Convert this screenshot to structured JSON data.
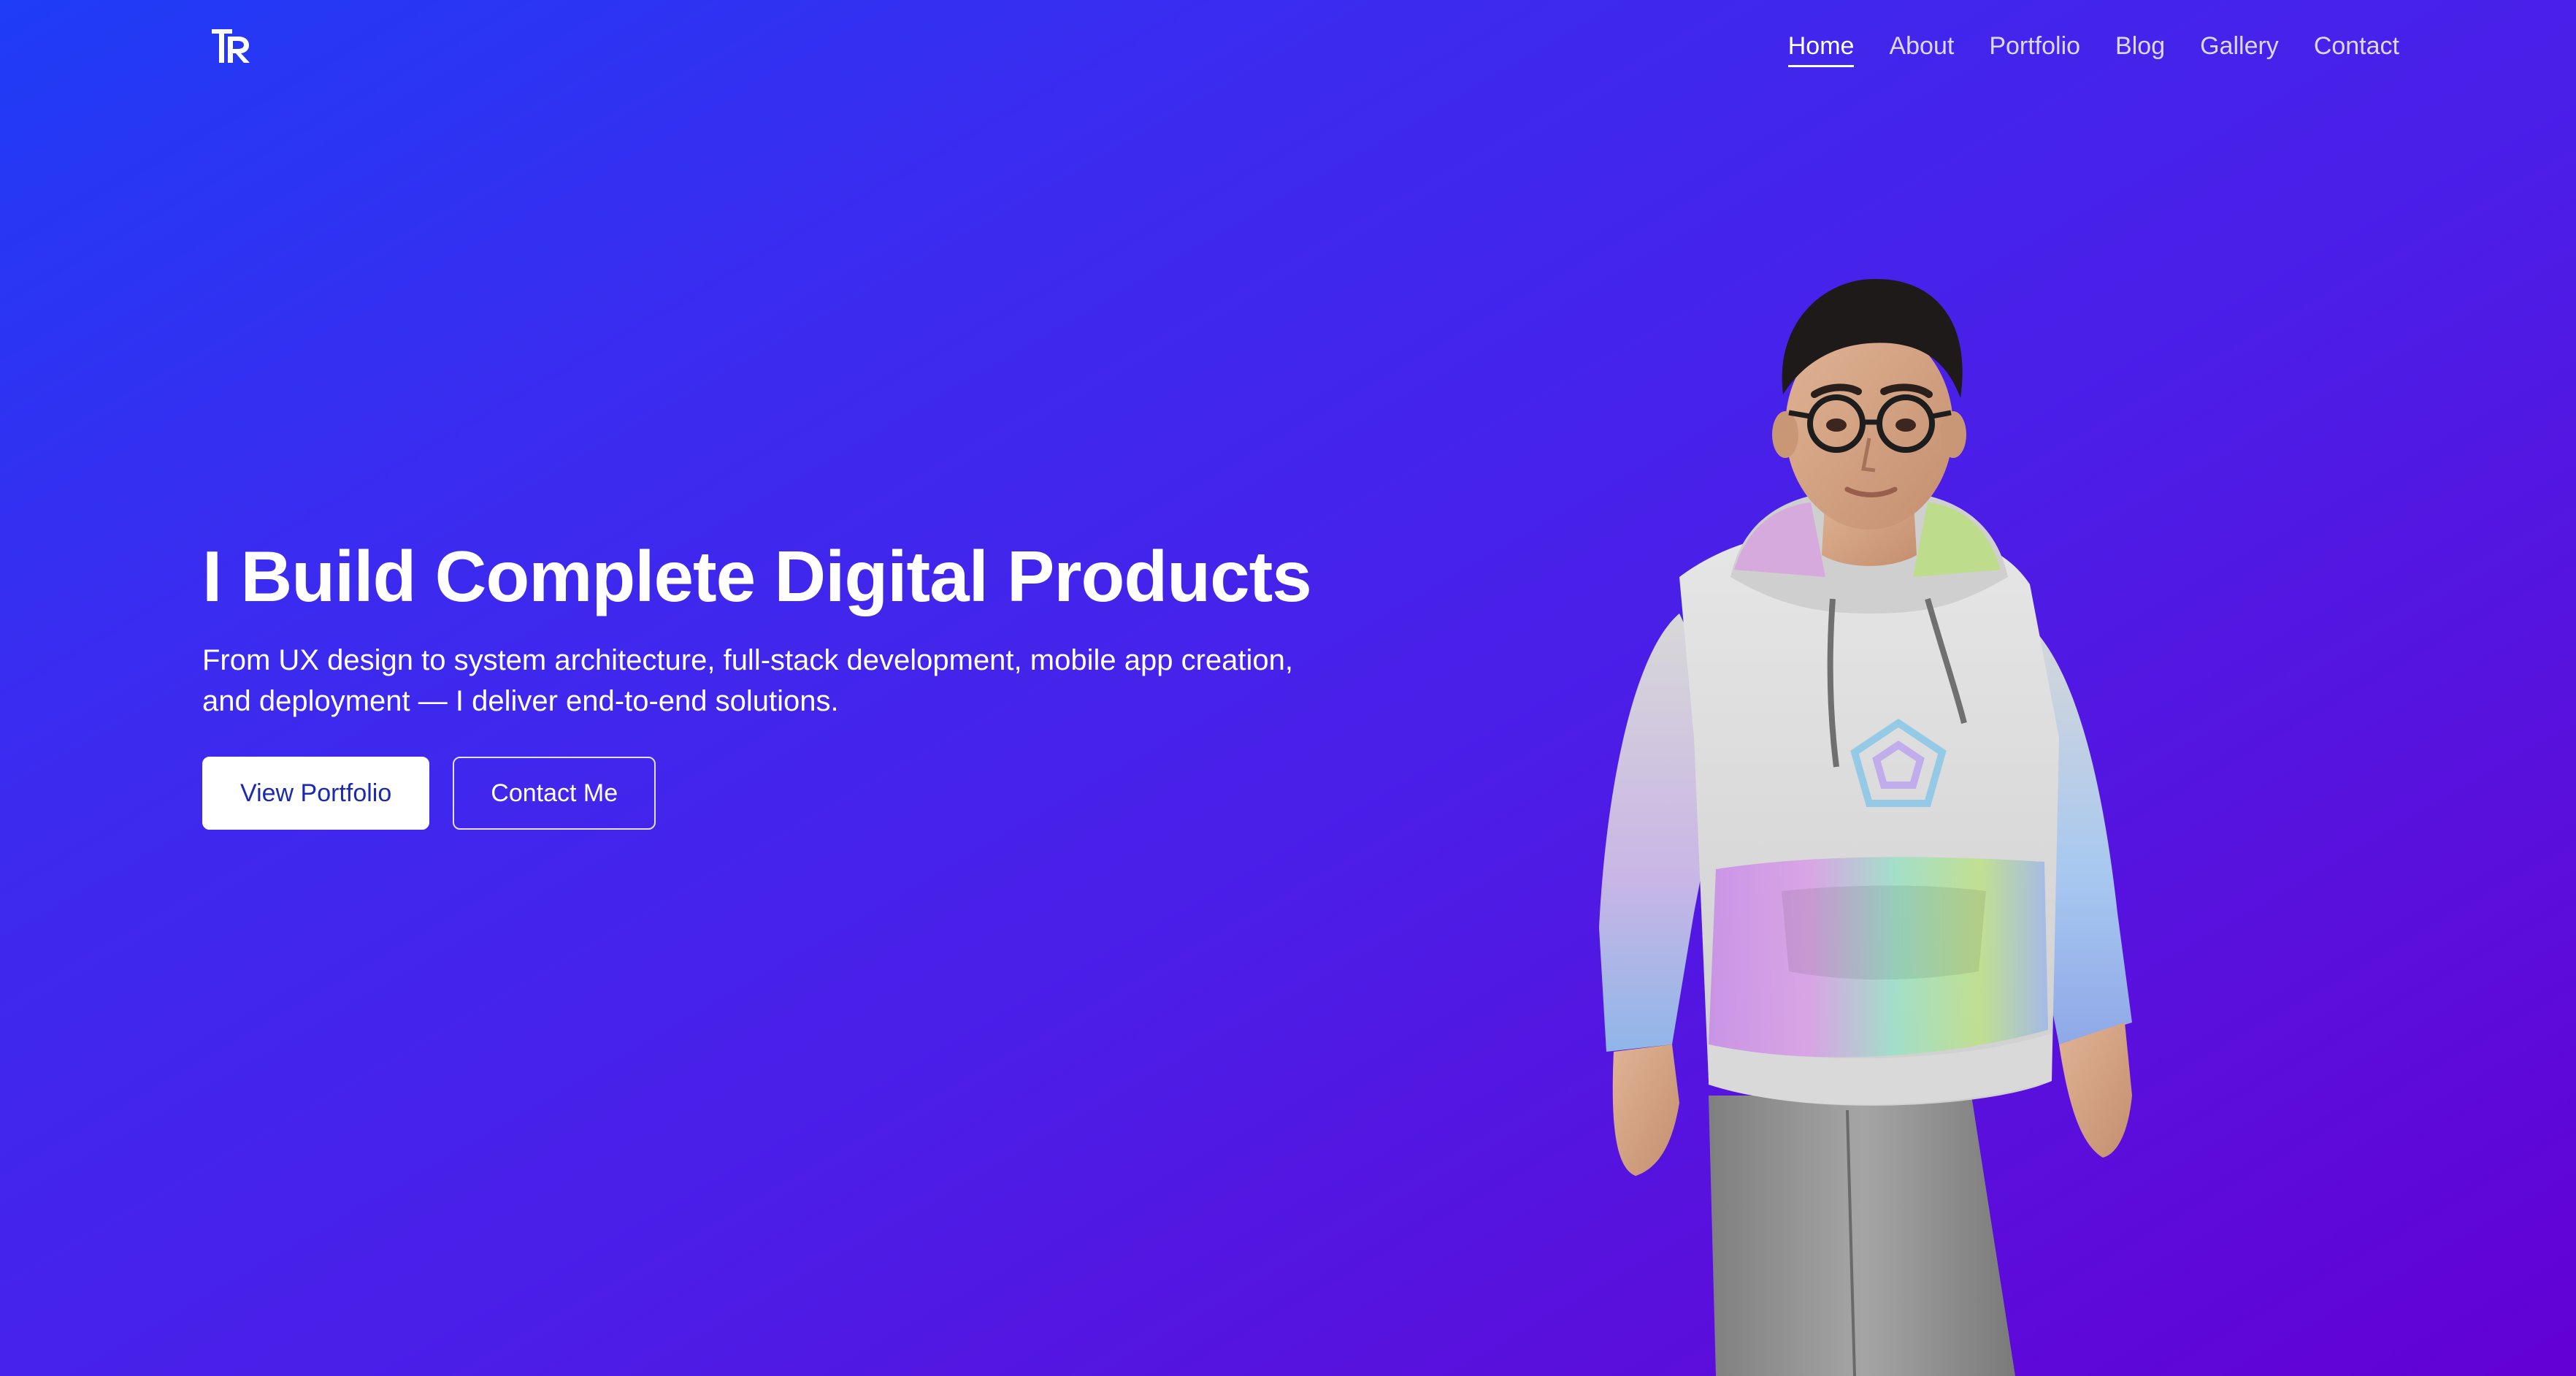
{
  "brand": {
    "logo_text": "TR"
  },
  "nav": {
    "items": [
      {
        "label": "Home",
        "active": true
      },
      {
        "label": "About"
      },
      {
        "label": "Portfolio"
      },
      {
        "label": "Blog"
      },
      {
        "label": "Gallery"
      },
      {
        "label": "Contact"
      }
    ]
  },
  "hero": {
    "title": "I Build Complete Digital Products",
    "subtitle_line1": "From UX design to system architecture, full-stack development, mobile app creation,",
    "subtitle_line2": "and deployment — I deliver end-to-end solutions.",
    "primary_button": "View Portfolio",
    "secondary_button": "Contact Me"
  },
  "colors": {
    "gradient_start": "#1f3cf6",
    "gradient_end": "#6200d6",
    "primary_button_text": "#1b2ab0"
  }
}
